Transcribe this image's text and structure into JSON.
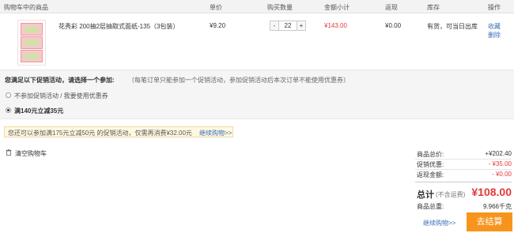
{
  "header": {
    "col_product": "购物车中的商品",
    "col_price": "单价",
    "col_qty": "购买数量",
    "col_subtotal": "金额小计",
    "col_rebate": "返现",
    "col_stock": "库存",
    "col_action": "操作"
  },
  "item": {
    "name": "花秀彩 200抽2层抽取式面纸-135（3包装）",
    "price": "¥9.20",
    "qty": "22",
    "minus": "-",
    "plus": "+",
    "subtotal": "¥143.00",
    "rebate": "¥0.00",
    "stock": "有货，可当日出库",
    "action_fav": "收藏",
    "action_del": "删除"
  },
  "promo": {
    "title": "您满足以下促销活动，请选择一个参加:",
    "note": "（每笔订单只能参加一个促销活动，参加促销活动后本次订单不能使用优惠券）",
    "option_none": "不参加促销活动 / 我要使用优惠券",
    "option_selected": "满140元立减35元"
  },
  "tip": {
    "text": "您还可以参加满175元立减50元 的促销活动，仅需再消费¥32.00元",
    "link": "继续购物>>"
  },
  "clear_cart": "清空购物车",
  "summary": {
    "total_label": "商品总价:",
    "total_value": "+¥202.40",
    "discount_label": "促销优惠:",
    "discount_value": "- ¥35.00",
    "rebate_label": "返现金额:",
    "rebate_value": "- ¥0.00",
    "grand_label": "总计",
    "grand_note": "(不含运费)",
    "grand_value": "¥108.00",
    "weight_label": "商品总重:",
    "weight_value": "9.966千克",
    "continue": "继续购物>>",
    "checkout": "去结算"
  }
}
